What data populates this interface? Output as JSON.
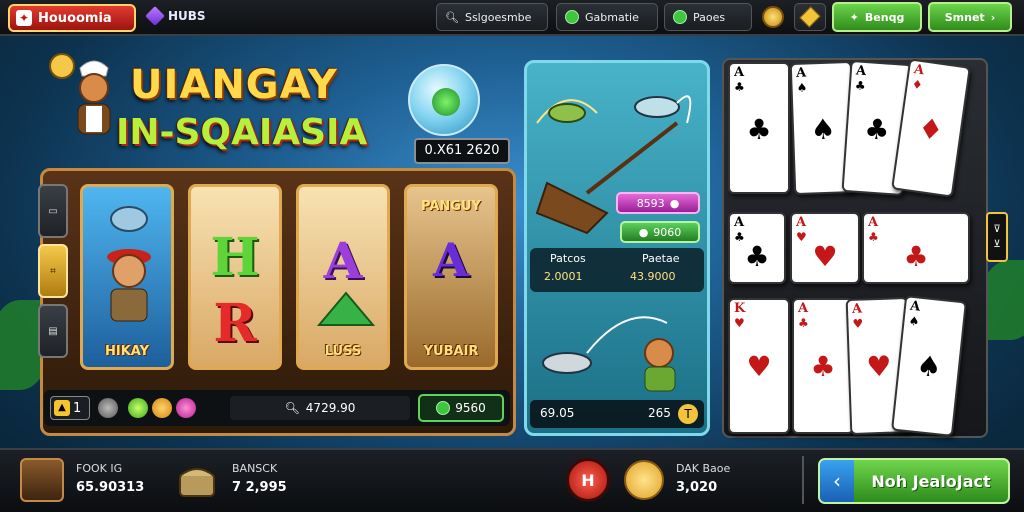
{
  "topbar": {
    "logo_text": "Houoomia",
    "hub_label": "HUBS",
    "search_label": "Sslgoesmbe",
    "center_label": "Gabmatie",
    "pill3_label": "Paoes",
    "bonus_label": "Benqg",
    "start_label": "Smnet"
  },
  "slot": {
    "title_line1": "UIANGAY",
    "title_line2": "IN-SQAIASIA",
    "jackpot_value": "0.X61 2620",
    "side_tab_labels": [
      "",
      "",
      ""
    ],
    "reels": [
      {
        "top": "",
        "letter": "",
        "label": "HIKAY"
      },
      {
        "top": "",
        "letter1": "H",
        "letter2": "R",
        "label": ""
      },
      {
        "top": "",
        "letter": "A",
        "label": "LUSS"
      },
      {
        "top": "PANGUY",
        "letter": "A",
        "label": "YUBAIR"
      }
    ],
    "bet_value": "1",
    "balance_value": "4729.90",
    "win_value": "9560"
  },
  "fishing": {
    "price_pink": "8593",
    "price_green": "9060",
    "stat1_label": "Patcos",
    "stat1_value": "2.0001",
    "stat2_label": "Paetae",
    "stat2_value": "43.9000",
    "bottom_left": "69.05",
    "bottom_right": "265"
  },
  "cards": {
    "row1": [
      {
        "rank": "A",
        "suit": "♣",
        "red": false
      },
      {
        "rank": "A",
        "suit": "♠",
        "red": false
      },
      {
        "rank": "A",
        "suit": "♣",
        "red": false
      },
      {
        "rank": "A",
        "suit": "♦",
        "red": true
      }
    ],
    "row2": [
      {
        "rank": "A",
        "suit": "♣",
        "red": false
      },
      {
        "rank": "A",
        "suit": "♥",
        "red": true
      },
      {
        "rank": "A",
        "suit": "♣",
        "red": true
      }
    ],
    "row3": [
      {
        "rank": "K",
        "suit": "♥",
        "red": true
      },
      {
        "rank": "A",
        "suit": "♣",
        "red": true
      },
      {
        "rank": "A",
        "suit": "♥",
        "red": true
      },
      {
        "rank": "A",
        "suit": "♠",
        "red": false
      }
    ],
    "nav_up": "⊽",
    "nav_down": "⊻"
  },
  "bottom": {
    "player_label": "FOOK IG",
    "player_value": "65.90313",
    "chest_label": "BANSCK",
    "chest_value": "7 2,995",
    "bonus_label": "DAK Baoe",
    "bonus_value": "3,020",
    "red_button_label": "H",
    "main_button_label": "Noh JealoJact"
  }
}
